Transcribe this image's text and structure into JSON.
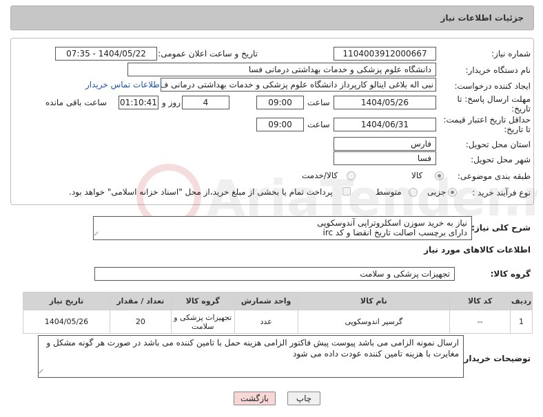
{
  "header": {
    "title": "جزئیات اطلاعات نیاز"
  },
  "form": {
    "need_number_label": "شماره نیاز:",
    "need_number": "1104003912000667",
    "announce_label": "تاریخ و ساعت اعلان عمومی:",
    "announce_value": "1404/05/22 - 07:35",
    "buyer_org_label": "نام دستگاه خریدار:",
    "buyer_org": "دانشگاه علوم پزشکی و خدمات بهداشتی درمانی فسا",
    "creator_label": "ایجاد کننده درخواست:",
    "creator": "نبی اله بلاغی اینالو کارپرداز دانشگاه علوم پزشکی و خدمات بهداشتی درمانی ف",
    "contact_link": "اطلاعات تماس خریدار",
    "deadline_label_1": "مهلت ارسال پاسخ: تا",
    "deadline_label_2": "تاریخ:",
    "deadline_date": "1404/05/26",
    "time_label": "ساعت",
    "deadline_time": "09:00",
    "days_value": "4",
    "days_label": "روز و",
    "remaining_time": "01:10:41",
    "remaining_label": "ساعت باقی مانده",
    "validity_label_1": "حداقل تاریخ اعتبار قیمت:",
    "validity_label_2": "تا تاریخ:",
    "validity_date": "1404/06/31",
    "validity_time": "09:00",
    "province_label": "استان محل تحویل:",
    "province": "فارس",
    "city_label": "شهر محل تحویل:",
    "city": "فسا",
    "category_label": "طبقه بندی موضوعی:",
    "category_options": [
      "کالا",
      "کالا/خدمت"
    ],
    "process_label": "نوع فرآیند خرید :",
    "process_options": [
      "جزیی",
      "متوسط"
    ],
    "payment_note": "پرداخت تمام یا بخشی از مبلغ خرید،از محل \"اسناد خزانه اسلامی\" خواهد بود."
  },
  "description": {
    "label": "شرح کلی نیاز:",
    "line1": "نیاز به خرید سوزن اسکلروتراپی آندوسکوپی",
    "line2": "دارای برچسب اصالت تاریخ انقضا و کد irc"
  },
  "goods_info": {
    "title": "اطلاعات کالاهای مورد نیاز",
    "group_label": "گروه کالا:",
    "group_value": "تجهیزات پزشکی و سلامت"
  },
  "table": {
    "headers": [
      "ردیف",
      "کد کالا",
      "نام کالا",
      "واحد شمارش",
      "گروه کالا",
      "تعداد / مقدار",
      "تاریخ نیاز"
    ],
    "rows": [
      [
        "1",
        "--",
        "گرسپر اندوسکوپی",
        "عدد",
        "تجهیزات پزشکی و سلامت",
        "20",
        "1404/05/26"
      ]
    ]
  },
  "buyer_notes": {
    "label": "توضیحات خریدار:",
    "text": "ارسال نمونه الزامی می باشد پیوست پیش فاکتور الزامی  هزینه حمل با تامین کننده می باشد در صورت هر گونه مشکل و مغایرت با هزینه تامین کننده عودت داده می شود"
  },
  "buttons": {
    "print": "چاپ",
    "back": "بازگشت"
  },
  "colors": {
    "header_bg": "#c6c6c6",
    "table_header_bg": "#d4d4d4",
    "link": "#1a55b0",
    "back_button_bg": "#f8d7d7"
  },
  "watermark": {
    "logo": "AriaTender.net"
  }
}
